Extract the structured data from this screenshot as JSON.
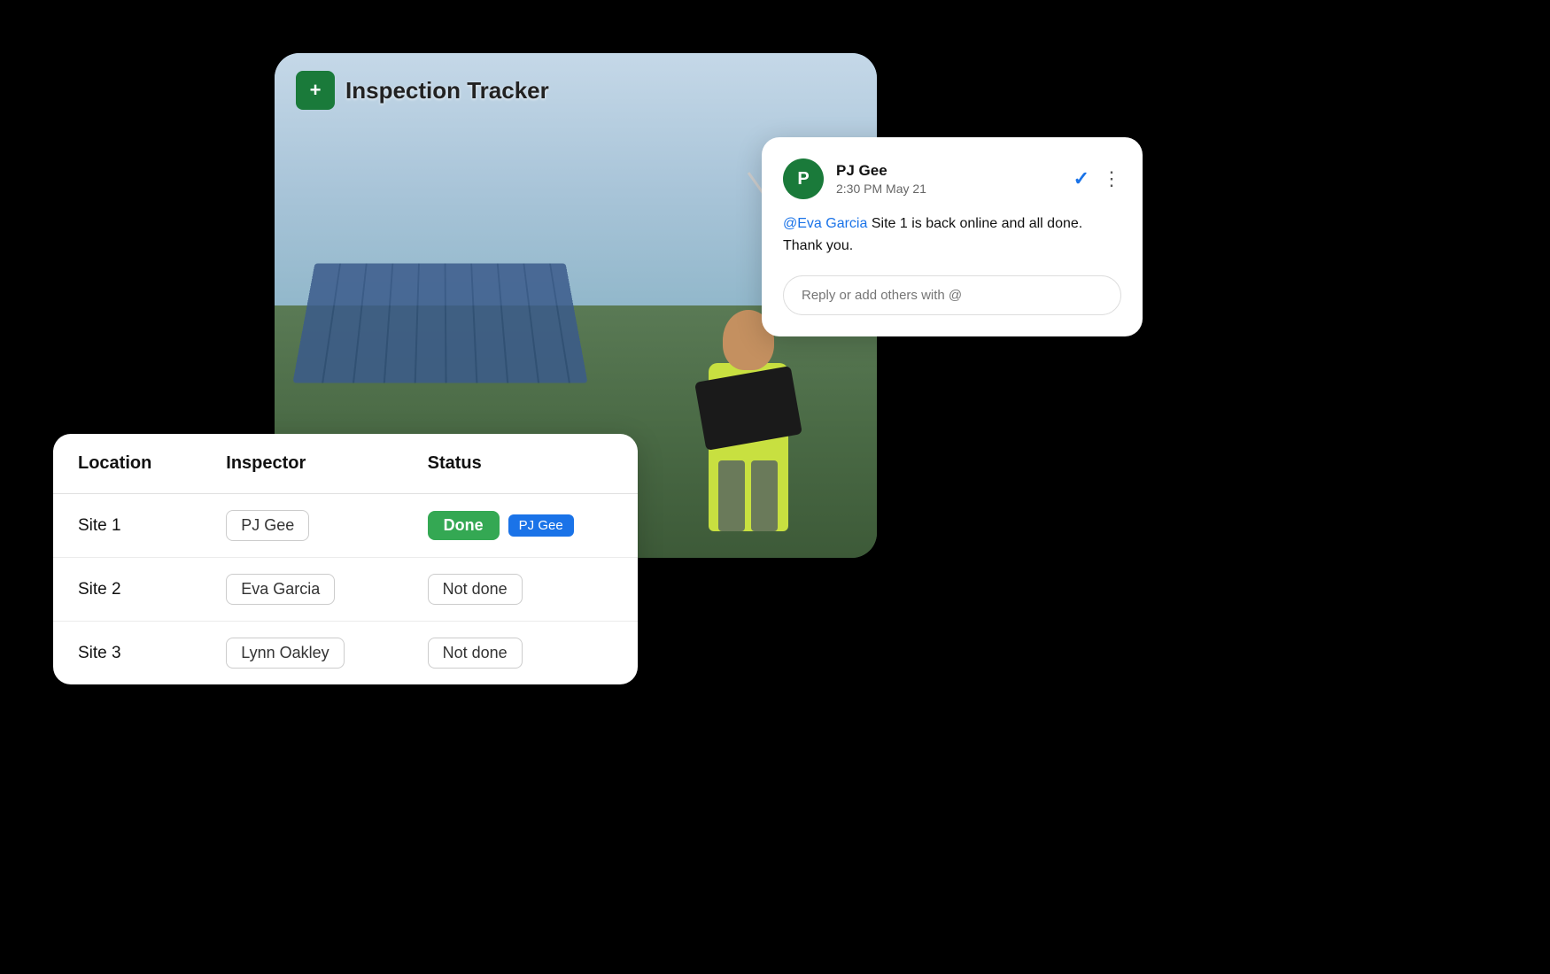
{
  "tracker": {
    "icon_symbol": "+",
    "title": "Inspection Tracker"
  },
  "comment_card": {
    "avatar_initial": "P",
    "author": "PJ Gee",
    "time": "2:30 PM May 21",
    "mention": "@Eva Garcia",
    "body_after_mention": " Site 1 is back online and all done. Thank you.",
    "reply_placeholder": "Reply or add others with @",
    "check_symbol": "✓",
    "more_symbol": "⋮"
  },
  "table": {
    "columns": [
      "Location",
      "Inspector",
      "Status"
    ],
    "rows": [
      {
        "location": "Site 1",
        "inspector": "PJ Gee",
        "status": "Done",
        "status_type": "done",
        "tag": "PJ Gee"
      },
      {
        "location": "Site 2",
        "inspector": "Eva Garcia",
        "status": "Not done",
        "status_type": "notdone",
        "tag": null
      },
      {
        "location": "Site 3",
        "inspector": "Lynn Oakley",
        "status": "Not done",
        "status_type": "notdone",
        "tag": null
      }
    ]
  }
}
